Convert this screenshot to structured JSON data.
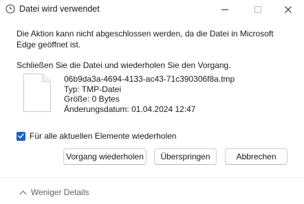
{
  "window": {
    "title": "Datei wird verwendet",
    "title_icon": "clock-icon",
    "controls": [
      "minimize-icon",
      "maximize-icon",
      "close-icon"
    ]
  },
  "message": "Die Aktion kann nicht abgeschlossen werden, da die Datei in Microsoft Edge geöffnet ist.",
  "instruction": "Schließen Sie die Datei und wiederholen Sie den Vorgang.",
  "file": {
    "icon": "file-icon",
    "name": "06b9da3a-4694-4133-ac43-71c390306f8a.tmp",
    "type": "Typ: TMP-Datei",
    "size": "Größe: 0 Bytes",
    "modified": "Änderungsdatum: 01.04.2024 12:47"
  },
  "apply_all": {
    "label": "Für alle aktuellen Elemente wiederholen",
    "checked": true
  },
  "buttons": {
    "retry": "Vorgang wiederholen",
    "skip": "Überspringen",
    "cancel": "Abbrechen"
  },
  "footer": {
    "details_label": "Weniger Details",
    "details_icon": "chevron-up-icon"
  },
  "colors": {
    "accent": "#1e5fc1"
  }
}
